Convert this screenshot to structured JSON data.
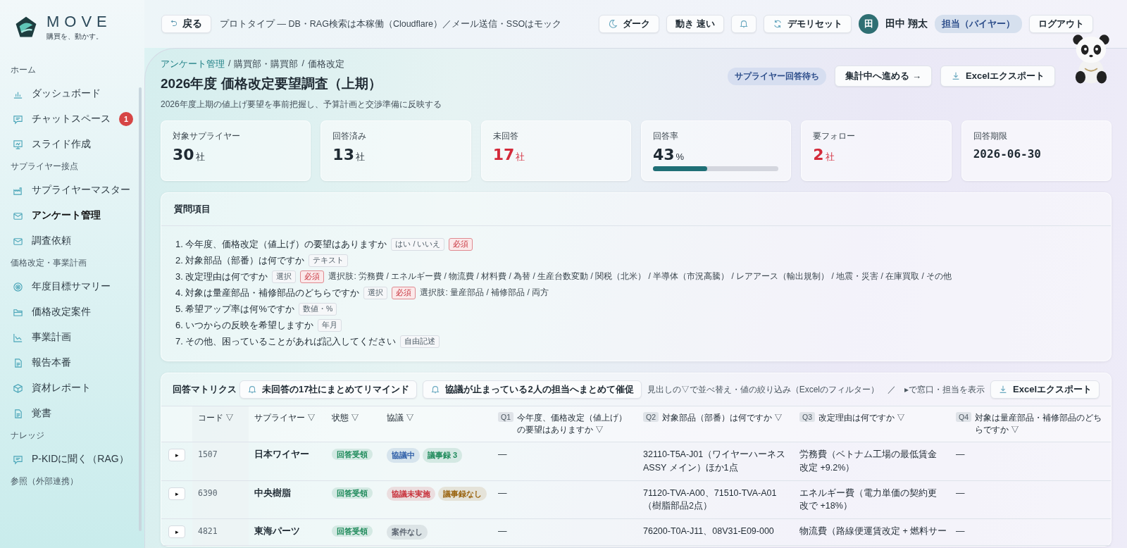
{
  "brand": {
    "name": "MOVE",
    "tagline": "購買を、動かす。"
  },
  "topbar": {
    "back": {
      "icon": "⮌",
      "label": "戻る"
    },
    "note": "プロトタイプ — DB・RAG検索は本稼働（Cloudflare）／メール送信・SSOはモック",
    "theme_button": "ダーク",
    "motion_button": "動き 速い",
    "reset_button": "デモリセット",
    "user": {
      "initial": "田",
      "name": "田中 翔太",
      "role": "担当（バイヤー）"
    },
    "logout": "ログアウト"
  },
  "sidebar": {
    "sections": [
      {
        "title": "ホーム",
        "items": [
          {
            "label": "ダッシュボード",
            "selected": false
          },
          {
            "label": "チャットスペース",
            "badge": "1",
            "selected": false
          },
          {
            "label": "スライド作成",
            "selected": false
          }
        ]
      },
      {
        "title": "サプライヤー接点",
        "items": [
          {
            "label": "サプライヤーマスター",
            "selected": false
          },
          {
            "label": "アンケート管理",
            "selected": true
          },
          {
            "label": "調査依頼",
            "selected": false
          }
        ]
      },
      {
        "title": "価格改定・事業計画",
        "items": [
          {
            "label": "年度目標サマリー",
            "selected": false
          },
          {
            "label": "価格改定案件",
            "selected": false
          },
          {
            "label": "事業計画",
            "selected": false
          },
          {
            "label": "報告本番",
            "selected": false
          },
          {
            "label": "資材レポート",
            "selected": false
          },
          {
            "label": "覚書",
            "selected": false
          }
        ]
      },
      {
        "title": "ナレッジ",
        "items": [
          {
            "label": "P-KIDに聞く（RAG）",
            "selected": false
          }
        ]
      },
      {
        "title": "参照（外部連携）"
      }
    ]
  },
  "page": {
    "breadcrumb": [
      {
        "label": "アンケート管理",
        "link": true
      },
      {
        "label": "購買部・購買部",
        "link": false
      },
      {
        "label": "価格改定",
        "link": false
      }
    ],
    "separator": "/",
    "title": "2026年度 価格改定要望調査（上期）",
    "subtitle": "2026年度上期の値上げ要望を事前把握し、予算計画と交渉準備に反映する",
    "status": "サプライヤー回答待ち",
    "advance_button": "集計中へ進める →",
    "export_button": "Excelエクスポート"
  },
  "stats": [
    {
      "kind": "count",
      "label": "対象サプライヤー",
      "value": "30",
      "unit": "社",
      "alert": false
    },
    {
      "kind": "count",
      "label": "回答済み",
      "value": "13",
      "unit": "社",
      "alert": false
    },
    {
      "kind": "count",
      "label": "未回答",
      "value": "17",
      "unit": "社",
      "alert": true
    },
    {
      "kind": "rate",
      "label": "回答率",
      "value": "43",
      "unit": "%",
      "level": 0.43
    },
    {
      "kind": "count",
      "label": "要フォロー",
      "value": "2",
      "unit": "社",
      "alert": true
    },
    {
      "kind": "date",
      "label": "回答期限",
      "value": "2026-06-30"
    }
  ],
  "questions": {
    "title": "質問項目",
    "items": [
      {
        "number": "1.",
        "text": "今年度、価格改定（値上げ）の要望はありますか",
        "tags": [
          {
            "kind": "type",
            "label": "はい / いいえ"
          },
          {
            "kind": "required",
            "label": "必須"
          }
        ]
      },
      {
        "number": "2.",
        "text": "対象部品（部番）は何ですか",
        "tags": [
          {
            "kind": "type",
            "label": "テキスト"
          }
        ]
      },
      {
        "number": "3.",
        "text": "改定理由は何ですか",
        "tags": [
          {
            "kind": "type",
            "label": "選択"
          },
          {
            "kind": "required",
            "label": "必須"
          }
        ],
        "options": "選択肢: 労務費 / エネルギー費 / 物流費 / 材料費 / 為替 / 生産台数変動 / 関税（北米） / 半導体（市況高騰） / レアアース（輸出規制） / 地震・災害 / 在庫買取 / その他"
      },
      {
        "number": "4.",
        "text": "対象は量産部品・補修部品のどちらですか",
        "tags": [
          {
            "kind": "type",
            "label": "選択"
          },
          {
            "kind": "required",
            "label": "必須"
          }
        ],
        "options": "選択肢: 量産部品 / 補修部品 / 両方"
      },
      {
        "number": "5.",
        "text": "希望アップ率は何%ですか",
        "tags": [
          {
            "kind": "type",
            "label": "数値・%"
          }
        ]
      },
      {
        "number": "6.",
        "text": "いつからの反映を希望しますか",
        "tags": [
          {
            "kind": "type",
            "label": "年月"
          }
        ]
      },
      {
        "number": "7.",
        "text": "その他、困っていることがあれば記入してください",
        "tags": [
          {
            "kind": "type",
            "label": "自由記述"
          }
        ]
      }
    ]
  },
  "matrix": {
    "title": "回答マトリクス",
    "remind_button": "未回答の17社にまとめてリマインド",
    "nudge_button": "協議が止まっている2人の担当へまとめて催促",
    "hint": "見出しの▽で並べ替え・値の絞り込み（Excelのフィルター）　／　▸で窓口・担当を表示",
    "export_button": "Excelエクスポート",
    "columns": [
      {
        "label": "コード ▽"
      },
      {
        "label": "サプライヤー ▽"
      },
      {
        "label": "状態 ▽"
      },
      {
        "label": "協議 ▽"
      },
      {
        "tag": "Q1",
        "label": "今年度、価格改定（値上げ）の要望はありますか ▽"
      },
      {
        "tag": "Q2",
        "label": "対象部品（部番）は何ですか ▽"
      },
      {
        "tag": "Q3",
        "label": "改定理由は何ですか ▽"
      },
      {
        "tag": "Q4",
        "label": "対象は量産部品・補修部品のどちらですか ▽"
      }
    ],
    "rows": [
      {
        "toggle": "▸",
        "code": "1507",
        "supplier": "日本ワイヤー",
        "status": {
          "label": "回答受領",
          "color": "#1e8a5a"
        },
        "negotiation": [
          {
            "label": "協議中",
            "color": "#2f5fa8"
          },
          {
            "label": "議事録 3",
            "color": "#1e8a5a"
          }
        ],
        "answers": [
          "—",
          "32110-T5A-J01（ワイヤーハーネス ASSY メイン）ほか1点",
          "労務費（ベトナム工場の最低賃金改定 +9.2%）",
          "—"
        ]
      },
      {
        "toggle": "▸",
        "code": "6390",
        "supplier": "中央樹脂",
        "status": {
          "label": "回答受領",
          "color": "#1e8a5a"
        },
        "negotiation": [
          {
            "label": "協議未実施",
            "color": "#c8323c"
          },
          {
            "label": "議事録なし",
            "color": "#9a6410"
          }
        ],
        "answers": [
          "—",
          "71120-TVA-A00、71510-TVA-A01（樹脂部品2点）",
          "エネルギー費（電力単価の契約更改で +18%）",
          "—"
        ]
      },
      {
        "toggle": "▸",
        "code": "4821",
        "supplier": "東海パーツ",
        "status": {
          "label": "回答受領",
          "color": "#1e8a5a"
        },
        "negotiation": [
          {
            "label": "案件なし",
            "color": "#5b6470"
          }
        ],
        "answers": [
          "—",
          "76200-T0A-J11、08V31-E09-000",
          "物流費（路線便運賃改定 + 燃料サー",
          "—"
        ]
      }
    ]
  }
}
